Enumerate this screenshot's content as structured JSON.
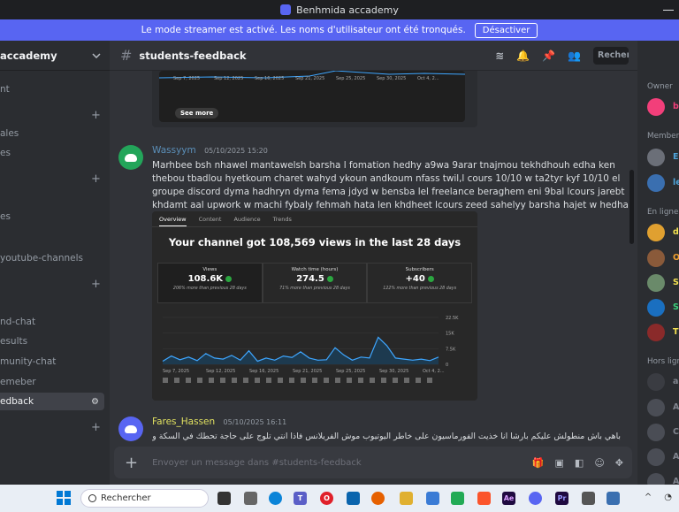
{
  "window": {
    "title": "Benhmida accademy"
  },
  "banner": {
    "text": "Le mode streamer est activé. Les noms d'utilisateur ont été tronqués.",
    "button": "Désactiver"
  },
  "server": {
    "name": "accademy"
  },
  "channels": [
    {
      "label": "nt",
      "y": 49
    },
    {
      "label": "ales",
      "y": 99
    },
    {
      "label": "es",
      "y": 121
    },
    {
      "label": "es",
      "y": 193
    },
    {
      "label": "youtube-channels",
      "y": 240
    },
    {
      "label": "nd-chat",
      "y": 312
    },
    {
      "label": "esults",
      "y": 334
    },
    {
      "label": "munity-chat",
      "y": 357
    },
    {
      "label": "emeber",
      "y": 380
    }
  ],
  "active_channel": {
    "label": "edback"
  },
  "header": {
    "channel": "students-feedback",
    "search_placeholder": "Rechercher"
  },
  "top_embed": {
    "ticks": [
      "Sep 7, 2025",
      "Sep 12, 2025",
      "Sep 16, 2025",
      "Sep 21, 2025",
      "Sep 25, 2025",
      "Sep 30, 2025",
      "Oct 4, 2..."
    ],
    "see_more": "See more"
  },
  "messages": [
    {
      "author": "Wassyym",
      "author_color": "#5b8fb9",
      "timestamp": "05/10/2025 15:20",
      "text": "Marhbee bsh nhawel mantawelsh barsha l fomation hedhy a9wa 9arar tnajmou tekhdhouh edha ken thebou tbadlou hyetkoum charet wahyd ykoun andkoum nfass twil,l cours 10/10 w ta2tyr kyf 10/10 el groupe discord dyma hadhryn dyma fema jdyd w bensba lel freelance beraghem eni 9bal lcours jarebt khdamt aal upwork w machi fybaly fehmah hata len khdheet lcours zeed sahelyy barsha hajet  w hedha shnu aamalt chhar lawel."
    },
    {
      "author": "Fares_Hassen",
      "author_color": "#e0e060",
      "timestamp": "05/10/2025 16:11",
      "text": "باهي باش منطولش عليكم بارشا انا خذيت الفورماسيون على خاطر اليوتيوب موش الفريلانس فاذا انتي تلوج على حاجة تحطك في السكة وتفهمك اليوتيوب من"
    }
  ],
  "analytics": {
    "tabs": [
      "Overview",
      "Content",
      "Audience",
      "Trends"
    ],
    "headline": "Your channel got 108,569 views in the last 28 days",
    "metrics": [
      {
        "label": "Views",
        "value": "108.6K",
        "note": "206% more than previous 28 days"
      },
      {
        "label": "Watch time (hours)",
        "value": "274.5",
        "note": "71% more than previous 28 days"
      },
      {
        "label": "Subscribers",
        "value": "+40",
        "note": "122% more than previous 28 days"
      }
    ]
  },
  "chart_data": {
    "type": "area",
    "title": "",
    "xlabel": "",
    "ylabel": "",
    "x": [
      "Sep 7, 2025",
      "Sep 12, 2025",
      "Sep 16, 2025",
      "Sep 21, 2025",
      "Sep 25, 2025",
      "Sep 30, 2025",
      "Oct 4, 2..."
    ],
    "y_ticks": [
      "0",
      "7.5K",
      "15K",
      "22.5K"
    ],
    "ylim": [
      0,
      22500
    ],
    "values": [
      1500,
      4000,
      2200,
      3500,
      1800,
      5200,
      3000,
      2500,
      4300,
      2000,
      6500,
      1500,
      3000,
      2000,
      4000,
      3300,
      6000,
      3000,
      2000,
      2200,
      8000,
      4500,
      2000,
      3500,
      3000,
      13000,
      9000,
      3000,
      2500,
      2000,
      2500,
      1800,
      3500
    ]
  },
  "composer": {
    "placeholder": "Envoyer un message dans #students-feedback"
  },
  "members_panel": {
    "sections": [
      {
        "label": "Owner",
        "y": 47
      },
      {
        "label": "Member",
        "y": 103
      },
      {
        "label": "En ligne",
        "y": 189
      },
      {
        "label": "Hors lign",
        "y": 358
      }
    ],
    "members": [
      {
        "initial": "b",
        "color": "#f23f7a",
        "name_color": "#f23f7a",
        "y": 65
      },
      {
        "initial": "E",
        "color": "#6b6f78",
        "name_color": "#4fa3d9",
        "y": 122
      },
      {
        "initial": "le",
        "color": "#3a6fb0",
        "name_color": "#4fa3d9",
        "y": 151
      },
      {
        "initial": "d",
        "color": "#e0a030",
        "name_color": "#f2e050",
        "y": 207
      },
      {
        "initial": "O",
        "color": "#8a5a3a",
        "name_color": "#f2a030",
        "y": 236
      },
      {
        "initial": "S",
        "color": "#6a8a6a",
        "name_color": "#f2e050",
        "y": 264
      },
      {
        "initial": "S",
        "color": "#1a6fc0",
        "name_color": "#3ad07a",
        "y": 292
      },
      {
        "initial": "T",
        "color": "#8a2a2a",
        "name_color": "#f2e050",
        "y": 320
      },
      {
        "initial": "a",
        "color": "#3a3c42",
        "name_color": "#80848e",
        "y": 376
      },
      {
        "initial": "A",
        "color": "#4a4d55",
        "name_color": "#80848e",
        "y": 405
      },
      {
        "initial": "C",
        "color": "#4a4d55",
        "name_color": "#80848e",
        "y": 433
      },
      {
        "initial": "A",
        "color": "#4a4d55",
        "name_color": "#80848e",
        "y": 461
      },
      {
        "initial": "A",
        "color": "#4a4d55",
        "name_color": "#80848e",
        "y": 489
      }
    ]
  },
  "taskbar": {
    "search": "Rechercher"
  }
}
